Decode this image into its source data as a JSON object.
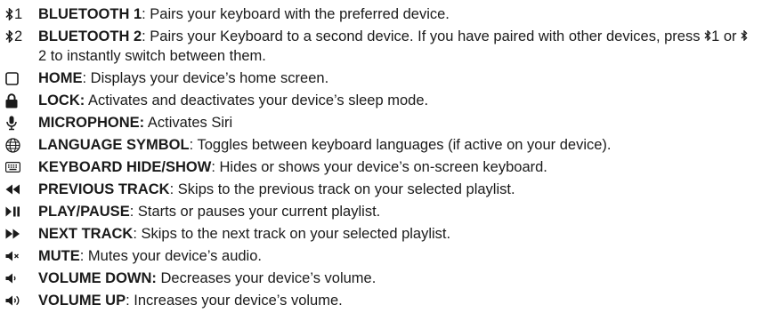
{
  "items": [
    {
      "icon_name": "bluetooth-1-icon",
      "icon_text": "1",
      "label": "BLUETOOTH 1",
      "sep": ": ",
      "desc": "Pairs your keyboard with the preferred device."
    },
    {
      "icon_name": "bluetooth-2-icon",
      "icon_text": "2",
      "label": "BLUETOOTH 2",
      "sep": ": ",
      "desc": "Pairs your Keyboard to a second device. If you have paired with other devices, press",
      "desc_key1": "1",
      "desc_mid": " or ",
      "desc_key2": "2",
      "desc_tail": " to instantly switch between them."
    },
    {
      "icon_name": "home-square-icon",
      "label": "HOME",
      "sep": ": ",
      "desc": "Displays your device’s home screen."
    },
    {
      "icon_name": "lock-icon",
      "label": "LOCK:",
      "sep": " ",
      "desc": "Activates and deactivates your device’s sleep mode."
    },
    {
      "icon_name": "microphone-icon",
      "label": "MICROPHONE:",
      "sep": " ",
      "desc": "Activates Siri"
    },
    {
      "icon_name": "globe-icon",
      "label": "LANGUAGE SYMBOL",
      "sep": ": ",
      "desc": "Toggles between keyboard languages (if active on your device)."
    },
    {
      "icon_name": "keyboard-icon",
      "label": "KEYBOARD HIDE/SHOW",
      "sep": ": ",
      "desc": "Hides or shows your device’s on-screen keyboard."
    },
    {
      "icon_name": "previous-track-icon",
      "label": "PREVIOUS TRACK",
      "sep": ": ",
      "desc": "Skips to the previous track on your selected playlist."
    },
    {
      "icon_name": "play-pause-icon",
      "label": "PLAY/PAUSE",
      "sep": ": ",
      "desc": "Starts or pauses your current playlist."
    },
    {
      "icon_name": "next-track-icon",
      "label": "NEXT TRACK",
      "sep": ": ",
      "desc": "Skips to the next track on your selected playlist."
    },
    {
      "icon_name": "mute-icon",
      "label": "MUTE",
      "sep": ": ",
      "desc": "Mutes your device’s audio."
    },
    {
      "icon_name": "volume-down-icon",
      "label": "VOLUME DOWN:",
      "sep": " ",
      "desc": "Decreases your device’s volume."
    },
    {
      "icon_name": "volume-up-icon",
      "label": "VOLUME UP",
      "sep": ": ",
      "desc": "Increases your device’s volume."
    }
  ]
}
